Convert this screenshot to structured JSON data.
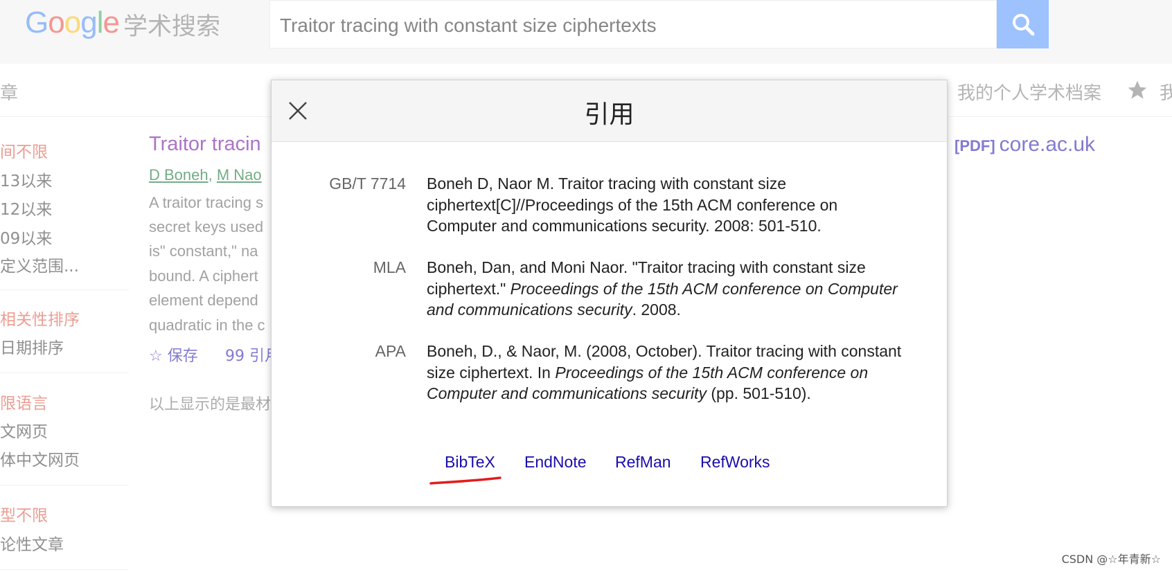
{
  "header": {
    "logo_letters": [
      "G",
      "o",
      "o",
      "g",
      "l",
      "e"
    ],
    "logo_subtitle": "学术搜索",
    "search_value": "Traitor tracing with constant size ciphertexts",
    "search_icon": "search-icon"
  },
  "subbar": {
    "left_fragment": "章",
    "profile_label": "我的个人学术档案",
    "star_icon": "star-icon",
    "right_fragment": "我"
  },
  "sidebar": {
    "groups": [
      {
        "items": [
          {
            "label": "间不限",
            "active": true
          },
          {
            "label": "13以来",
            "active": false
          },
          {
            "label": "12以来",
            "active": false
          },
          {
            "label": "09以来",
            "active": false
          },
          {
            "label": "定义范围...",
            "active": false
          }
        ]
      },
      {
        "items": [
          {
            "label": "相关性排序",
            "active": true
          },
          {
            "label": "日期排序",
            "active": false
          }
        ]
      },
      {
        "items": [
          {
            "label": "限语言",
            "active": true
          },
          {
            "label": "文网页",
            "active": false
          },
          {
            "label": "体中文网页",
            "active": false
          }
        ]
      },
      {
        "items": [
          {
            "label": "型不限",
            "active": true
          },
          {
            "label": "论性文章",
            "active": false
          }
        ]
      }
    ]
  },
  "result": {
    "title": "Traitor tracin",
    "authors": [
      "D Boneh",
      "M Nao"
    ],
    "snippet_lines": [
      "A traitor tracing s",
      "secret keys used",
      "is\" constant,\" na",
      "bound. A ciphert",
      "element depend",
      "quadratic in the c"
    ],
    "save_label": "☆ 保存",
    "cite_label": "99 引月",
    "pdf_tag": "[PDF]",
    "pdf_domain": "core.ac.uk"
  },
  "footer_note": "以上显示的是最材",
  "modal": {
    "title": "引用",
    "close_icon": "close-icon",
    "citations": [
      {
        "label": "GB/T 7714",
        "text": "Boneh D, Naor M. Traitor tracing with constant size ciphertext[C]//Proceedings of the 15th ACM conference on Computer and communications security. 2008: 501-510."
      },
      {
        "label": "MLA",
        "text_before": "Boneh, Dan, and Moni Naor. \"Traitor tracing with constant size ciphertext.\" ",
        "text_italic": "Proceedings of the 15th ACM conference on Computer and communications security",
        "text_after": ". 2008."
      },
      {
        "label": "APA",
        "text_before": "Boneh, D., & Naor, M. (2008, October). Traitor tracing with constant size ciphertext. In ",
        "text_italic": "Proceedings of the 15th ACM conference on Computer and communications security",
        "text_after": " (pp. 501-510)."
      }
    ],
    "export_links": [
      "BibTeX",
      "EndNote",
      "RefMan",
      "RefWorks"
    ]
  },
  "watermark": "CSDN @☆年青新☆",
  "colors": {
    "link": "#1a0dab",
    "visited": "#660099",
    "author": "#006621",
    "active_filter": "#dd4b39",
    "search_button": "#4d90fe",
    "annotation_red": "#e11d1d"
  }
}
